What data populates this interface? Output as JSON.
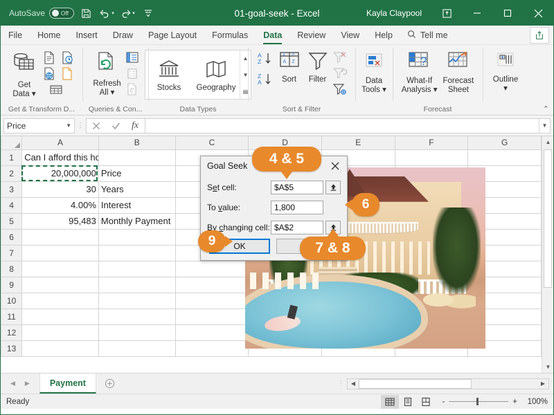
{
  "titlebar": {
    "autosave_label": "AutoSave",
    "autosave_state": "Off",
    "document_title": "01-goal-seek  -  Excel",
    "account_name": "Kayla Claypool",
    "save_icon": "save-icon",
    "undo_icon": "undo-icon",
    "redo_icon": "redo-icon",
    "customize_icon": "customize-quick-access-icon",
    "ribbon_display_icon": "ribbon-display-options-icon",
    "minimize_icon": "minimize-icon",
    "restore_icon": "restore-icon",
    "close_icon": "close-icon"
  },
  "tabs": [
    {
      "label": "File",
      "active": false
    },
    {
      "label": "Home",
      "active": false
    },
    {
      "label": "Insert",
      "active": false
    },
    {
      "label": "Draw",
      "active": false
    },
    {
      "label": "Page Layout",
      "active": false
    },
    {
      "label": "Formulas",
      "active": false
    },
    {
      "label": "Data",
      "active": true
    },
    {
      "label": "Review",
      "active": false
    },
    {
      "label": "View",
      "active": false
    },
    {
      "label": "Help",
      "active": false
    }
  ],
  "tellme": {
    "label": "Tell me",
    "icon": "search-icon"
  },
  "share": {
    "icon": "share-icon"
  },
  "ribbon": {
    "groups": [
      {
        "name": "Get & Transform D...",
        "buttons": [
          {
            "label": "Get\nData",
            "icon": "get-data-icon"
          },
          {
            "label": "",
            "icon": "from-text-csv-icon"
          },
          {
            "label": "",
            "icon": "from-web-icon"
          },
          {
            "label": "",
            "icon": "from-table-range-icon"
          },
          {
            "label": "",
            "icon": "recent-sources-icon"
          },
          {
            "label": "",
            "icon": "existing-connections-icon"
          }
        ]
      },
      {
        "name": "Queries & Con...",
        "buttons": [
          {
            "label": "Refresh\nAll",
            "icon": "refresh-all-icon"
          },
          {
            "label": "",
            "icon": "queries-connections-icon"
          },
          {
            "label": "",
            "icon": "properties-icon"
          },
          {
            "label": "",
            "icon": "edit-links-icon"
          }
        ]
      },
      {
        "name": "Data Types",
        "gallery": [
          {
            "label": "Stocks",
            "icon": "stocks-icon"
          },
          {
            "label": "Geography",
            "icon": "geography-icon"
          }
        ]
      },
      {
        "name": "Sort & Filter",
        "buttons": [
          {
            "label": "",
            "icon": "sort-ascending-icon"
          },
          {
            "label": "",
            "icon": "sort-descending-icon"
          },
          {
            "label": "Sort",
            "icon": "sort-icon"
          },
          {
            "label": "Filter",
            "icon": "filter-icon"
          },
          {
            "label": "",
            "icon": "clear-filter-icon"
          },
          {
            "label": "",
            "icon": "reapply-icon"
          },
          {
            "label": "",
            "icon": "advanced-filter-icon"
          }
        ]
      },
      {
        "name": "",
        "buttons": [
          {
            "label": "Data\nTools",
            "icon": "data-tools-icon"
          }
        ]
      },
      {
        "name": "Forecast",
        "buttons": [
          {
            "label": "What-If\nAnalysis",
            "icon": "what-if-analysis-icon"
          },
          {
            "label": "Forecast\nSheet",
            "icon": "forecast-sheet-icon"
          }
        ]
      },
      {
        "name": "",
        "buttons": [
          {
            "label": "Outline",
            "icon": "outline-icon"
          }
        ]
      }
    ],
    "group_labels": {
      "get_transform": "Get & Transform D...",
      "queries": "Queries & Con...",
      "data_types": "Data Types",
      "sort_filter": "Sort & Filter",
      "forecast": "Forecast"
    },
    "btn_get_data": "Get\nData",
    "btn_refresh_all": "Refresh\nAll",
    "btn_stocks": "Stocks",
    "btn_geography": "Geography",
    "btn_sort": "Sort",
    "btn_filter": "Filter",
    "btn_data_tools": "Data\nTools",
    "btn_what_if": "What-If\nAnalysis",
    "btn_forecast_sheet": "Forecast\nSheet",
    "btn_outline": "Outline",
    "collapse_icon": "collapse-ribbon-icon"
  },
  "formula_bar": {
    "name_box_value": "Price",
    "cancel_icon": "cancel-icon",
    "enter_icon": "enter-icon",
    "function_icon": "insert-function-icon",
    "formula_value": "",
    "expand_icon": "expand-formula-bar-icon"
  },
  "grid": {
    "columns": [
      "A",
      "B",
      "C",
      "D",
      "E",
      "F",
      "G"
    ],
    "rows": [
      "1",
      "2",
      "3",
      "4",
      "5",
      "6",
      "7",
      "8",
      "9",
      "10",
      "11",
      "12",
      "13"
    ],
    "cells": {
      "A1": "Can I afford this house?",
      "A2": "20,000,000",
      "B2": "Price",
      "A3": "30",
      "B3": "Years",
      "A4": "4.00%",
      "B4": "Interest",
      "A5": "95,483",
      "B5": "Monthly Payment"
    },
    "selected_cell": "A2"
  },
  "dialog": {
    "title": "Goal Seek",
    "close_icon": "close-icon",
    "fields": [
      {
        "label_pre": "S",
        "label_key": "e",
        "label_post": "t cell:",
        "value": "$A$5",
        "ref_icon": "collapse-dialog-icon"
      },
      {
        "label_pre": "To ",
        "label_key": "v",
        "label_post": "alue:",
        "value": "1,800",
        "ref_icon": ""
      },
      {
        "label_pre": "By ",
        "label_key": "c",
        "label_post": "hanging cell:",
        "value": "$A$2",
        "ref_icon": "collapse-dialog-icon"
      }
    ],
    "set_cell_label": "Set cell:",
    "to_value_label": "To value:",
    "by_changing_label": "By changing cell:",
    "set_cell_value": "$A$5",
    "to_value_value": "1,800",
    "by_changing_value": "$A$2",
    "ok_label": "OK",
    "cancel_label": "Cancel"
  },
  "callouts": [
    {
      "id": "c45",
      "label": "4 & 5",
      "direction": "down"
    },
    {
      "id": "c6",
      "label": "6",
      "direction": "left"
    },
    {
      "id": "c78",
      "label": "7 & 8",
      "direction": "up"
    },
    {
      "id": "c9",
      "label": "9",
      "direction": "right"
    }
  ],
  "sheet_tabs": {
    "prev_icon": "previous-sheet-icon",
    "next_icon": "next-sheet-icon",
    "tabs": [
      {
        "label": "Payment",
        "active": true
      }
    ],
    "add_icon": "add-sheet-icon"
  },
  "status_bar": {
    "status_text": "Ready",
    "view_normal_icon": "normal-view-icon",
    "view_pagelayout_icon": "page-layout-view-icon",
    "view_pagebreak_icon": "page-break-preview-icon",
    "zoom_out_label": "-",
    "zoom_in_label": "+",
    "zoom_level": "100%"
  },
  "photo": {
    "alt": "luxury-mansion-with-pool-photo"
  },
  "colors": {
    "excel_green": "#217346",
    "callout_orange": "#e8892b",
    "selection_green": "#1e7145",
    "focus_blue": "#0078d7"
  }
}
